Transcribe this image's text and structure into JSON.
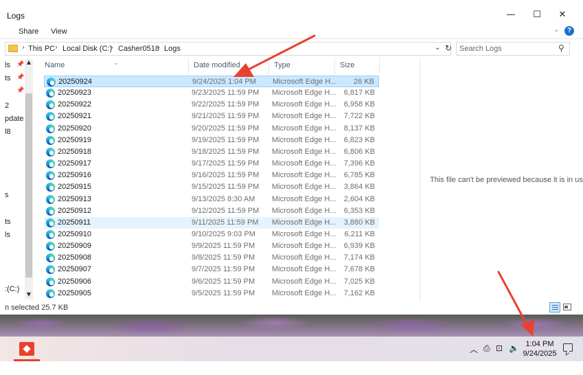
{
  "window": {
    "title": "Logs",
    "controls": {
      "minimize": "—",
      "maximize": "☐",
      "close": "✕"
    }
  },
  "ribbon": {
    "tabs": [
      "Share",
      "View"
    ],
    "expand_icon": "chevron-down-icon",
    "help_icon": "?"
  },
  "address": {
    "crumbs": [
      "This PC",
      "Local Disk (C:)",
      "Casher0518",
      "Logs"
    ],
    "search_placeholder": "Search Logs"
  },
  "nav": {
    "items": [
      "ls",
      "ts",
      "2",
      "pdate t",
      "l8",
      "s",
      "ts",
      "ls",
      ":(C:)"
    ]
  },
  "columns": {
    "name": "Name",
    "date": "Date modified",
    "type": "Type",
    "size": "Size"
  },
  "files": [
    {
      "name": "20250924",
      "date": "9/24/2025 1:04 PM",
      "type": "Microsoft Edge H...",
      "size": "26 KB"
    },
    {
      "name": "20250923",
      "date": "9/23/2025 11:59 PM",
      "type": "Microsoft Edge H...",
      "size": "6,817 KB"
    },
    {
      "name": "20250922",
      "date": "9/22/2025 11:59 PM",
      "type": "Microsoft Edge H...",
      "size": "6,958 KB"
    },
    {
      "name": "20250921",
      "date": "9/21/2025 11:59 PM",
      "type": "Microsoft Edge H...",
      "size": "7,722 KB"
    },
    {
      "name": "20250920",
      "date": "9/20/2025 11:59 PM",
      "type": "Microsoft Edge H...",
      "size": "8,137 KB"
    },
    {
      "name": "20250919",
      "date": "9/19/2025 11:59 PM",
      "type": "Microsoft Edge H...",
      "size": "6,823 KB"
    },
    {
      "name": "20250918",
      "date": "9/18/2025 11:59 PM",
      "type": "Microsoft Edge H...",
      "size": "6,806 KB"
    },
    {
      "name": "20250917",
      "date": "9/17/2025 11:59 PM",
      "type": "Microsoft Edge H...",
      "size": "7,396 KB"
    },
    {
      "name": "20250916",
      "date": "9/16/2025 11:59 PM",
      "type": "Microsoft Edge H...",
      "size": "6,785 KB"
    },
    {
      "name": "20250915",
      "date": "9/15/2025 11:59 PM",
      "type": "Microsoft Edge H...",
      "size": "3,864 KB"
    },
    {
      "name": "20250913",
      "date": "9/13/2025 8:30 AM",
      "type": "Microsoft Edge H...",
      "size": "2,604 KB"
    },
    {
      "name": "20250912",
      "date": "9/12/2025 11:59 PM",
      "type": "Microsoft Edge H...",
      "size": "6,353 KB"
    },
    {
      "name": "20250911",
      "date": "9/11/2025 11:59 PM",
      "type": "Microsoft Edge H...",
      "size": "3,880 KB"
    },
    {
      "name": "20250910",
      "date": "9/10/2025 9:03 PM",
      "type": "Microsoft Edge H...",
      "size": "6,211 KB"
    },
    {
      "name": "20250909",
      "date": "9/9/2025 11:59 PM",
      "type": "Microsoft Edge H...",
      "size": "6,939 KB"
    },
    {
      "name": "20250908",
      "date": "9/8/2025 11:59 PM",
      "type": "Microsoft Edge H...",
      "size": "7,174 KB"
    },
    {
      "name": "20250907",
      "date": "9/7/2025 11:59 PM",
      "type": "Microsoft Edge H...",
      "size": "7,678 KB"
    },
    {
      "name": "20250906",
      "date": "9/6/2025 11:59 PM",
      "type": "Microsoft Edge H...",
      "size": "7,025 KB"
    },
    {
      "name": "20250905",
      "date": "9/5/2025 11:59 PM",
      "type": "Microsoft Edge H...",
      "size": "7,162 KB"
    }
  ],
  "selected_index": 0,
  "hover_index": 12,
  "file_icon": "edge-html-icon",
  "preview": {
    "message": "This file can't be previewed because it is in use."
  },
  "status": {
    "text": "n selected  25.7 KB"
  },
  "taskbar": {
    "clock_time": "1:04 PM",
    "clock_date": "9/24/2025",
    "tray_icons": [
      "chevron-up-icon",
      "meet-now-icon",
      "network-icon",
      "volume-icon"
    ],
    "app_icon": "app-icon",
    "app_color": "#e8412f"
  },
  "annotations": {
    "arrow_color": "#e8412f"
  }
}
